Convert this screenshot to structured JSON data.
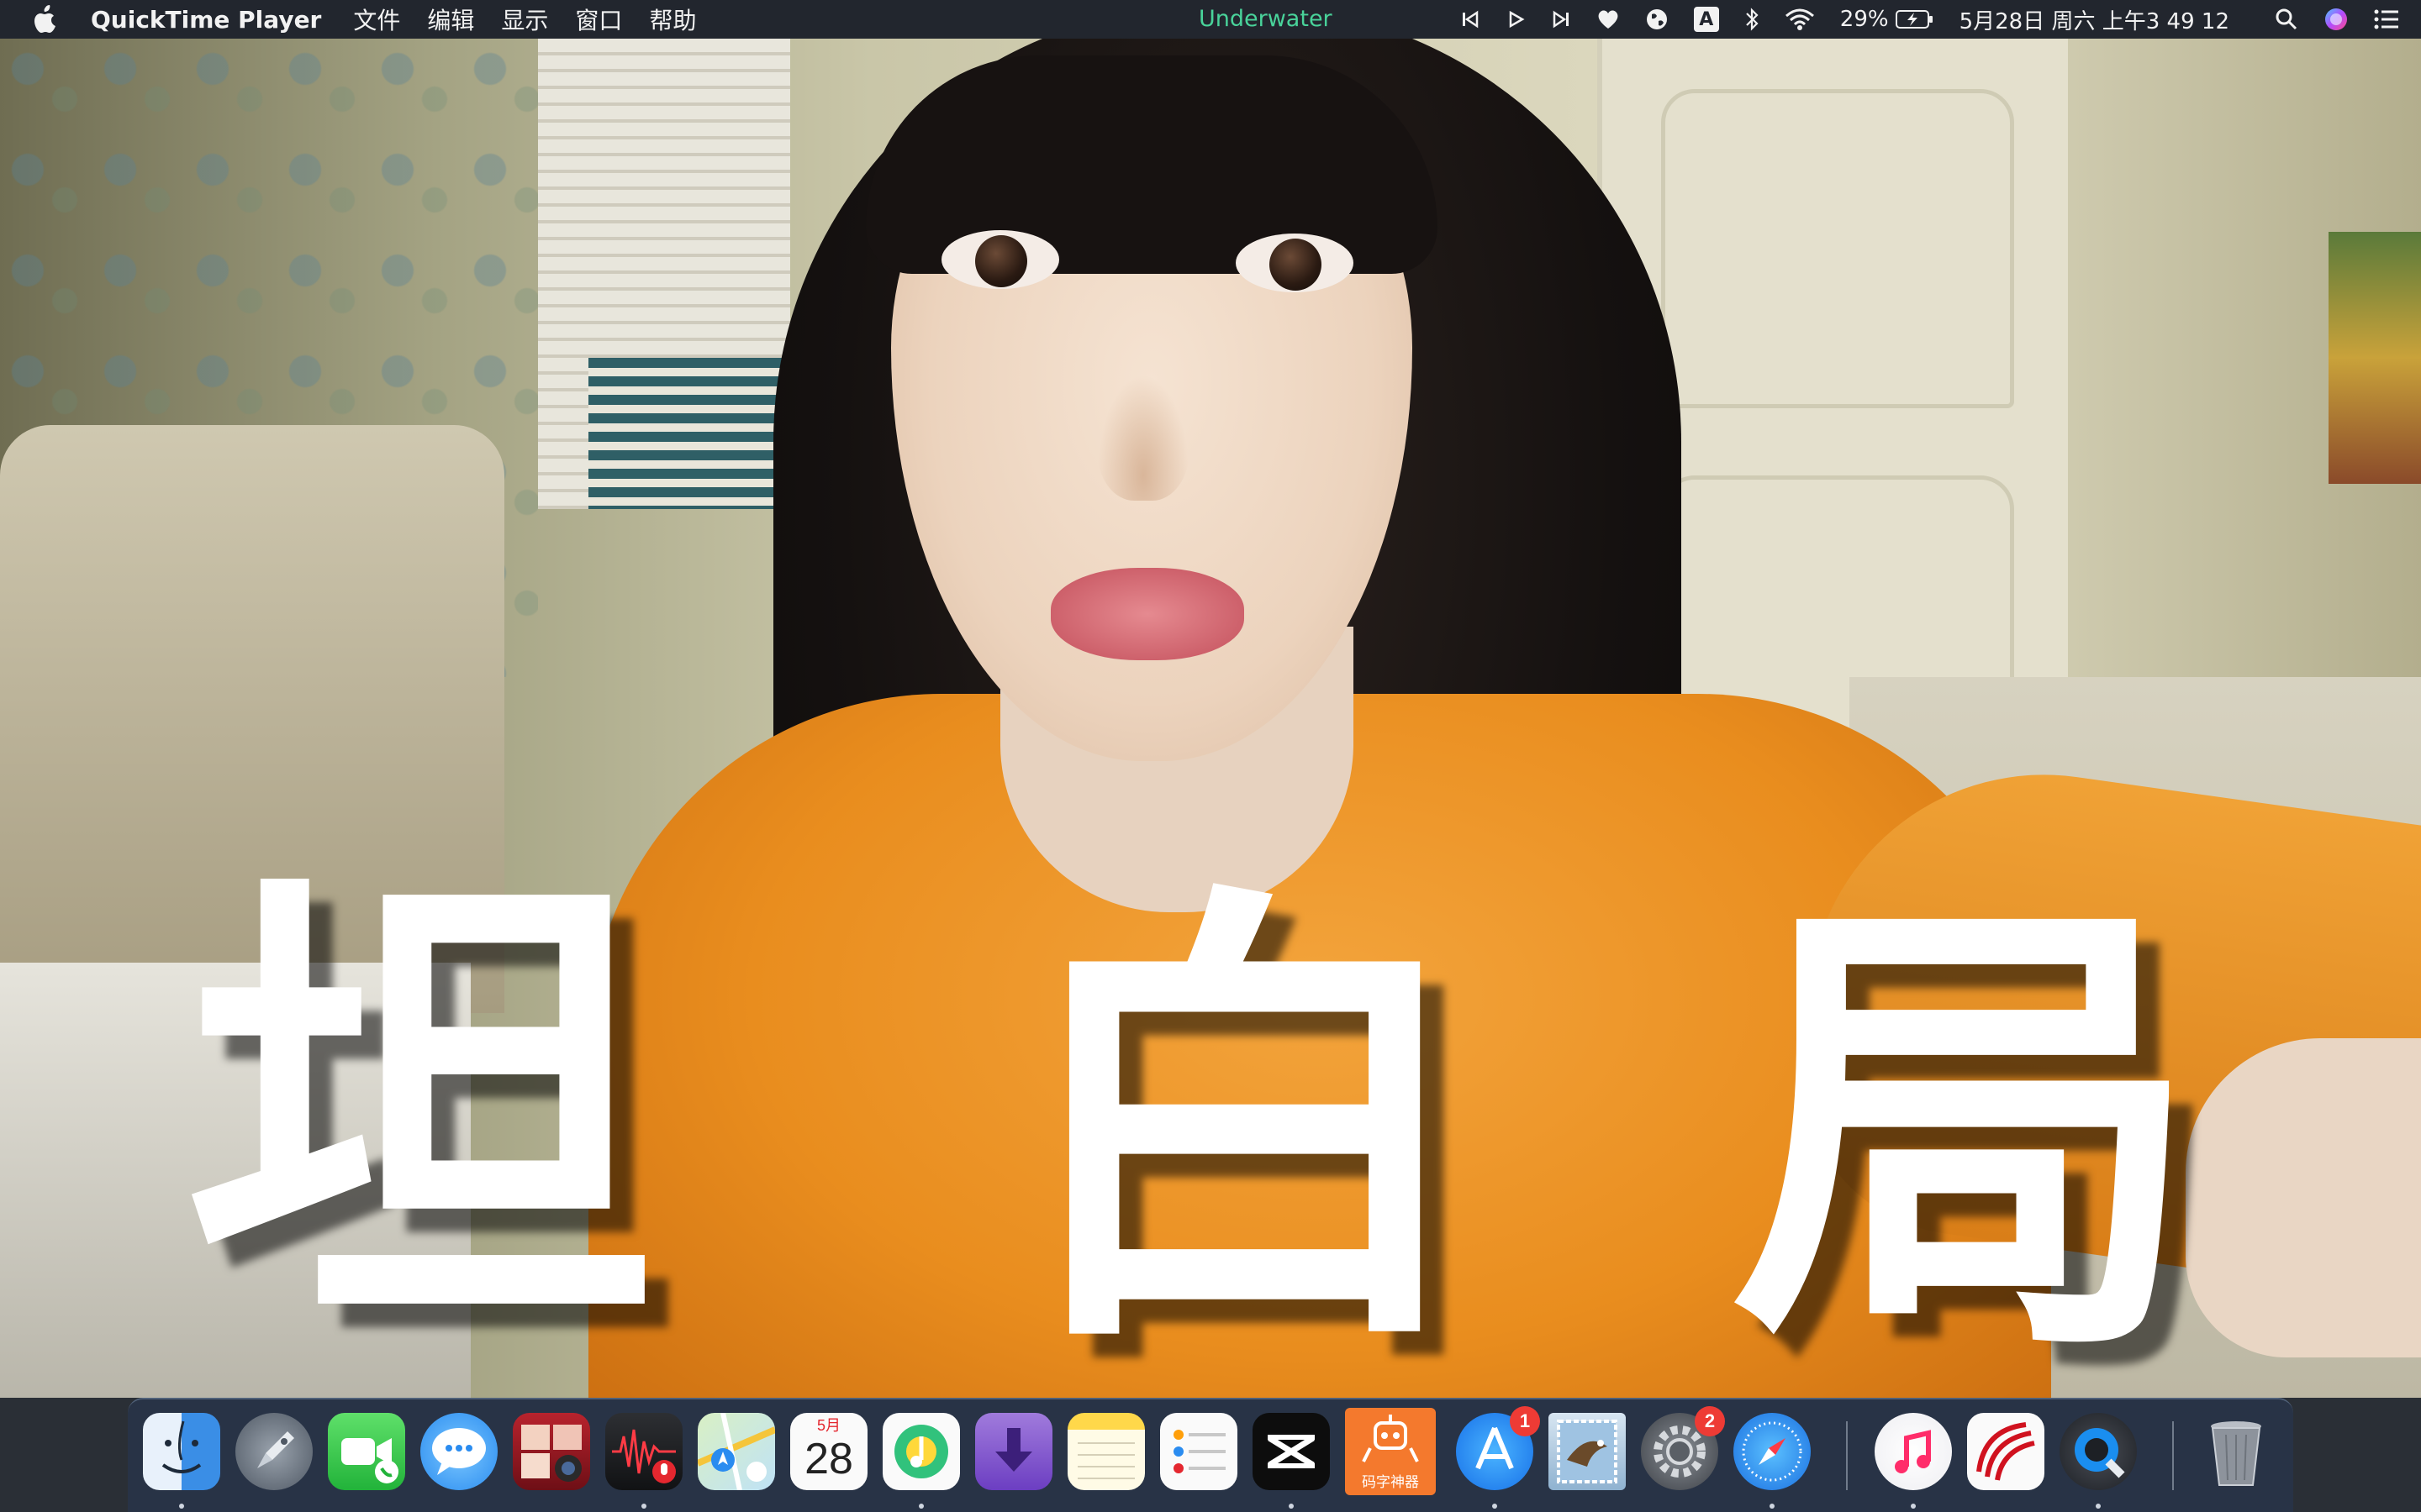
{
  "menubar": {
    "app_name": "QuickTime Player",
    "menus": [
      "文件",
      "编辑",
      "显示",
      "窗口",
      "帮助"
    ],
    "now_playing": "Underwater",
    "status": {
      "keyboard_input": "A",
      "battery": "29%",
      "clock": "5月28日 周六 上午3 49 12"
    }
  },
  "video": {
    "caption_chars": [
      "坦",
      "白",
      "局"
    ]
  },
  "dock": {
    "calendar_month": "5月",
    "calendar_day": "28",
    "tool_label": "码字神器",
    "app_store_badge": "1",
    "system_prefs_badge": "2"
  },
  "colors": {
    "menubar_bg": "#22262e",
    "now_playing": "#49d39a",
    "shirt": "#e98d1e",
    "badge": "#ee3b35",
    "caption": "#ffffff"
  }
}
